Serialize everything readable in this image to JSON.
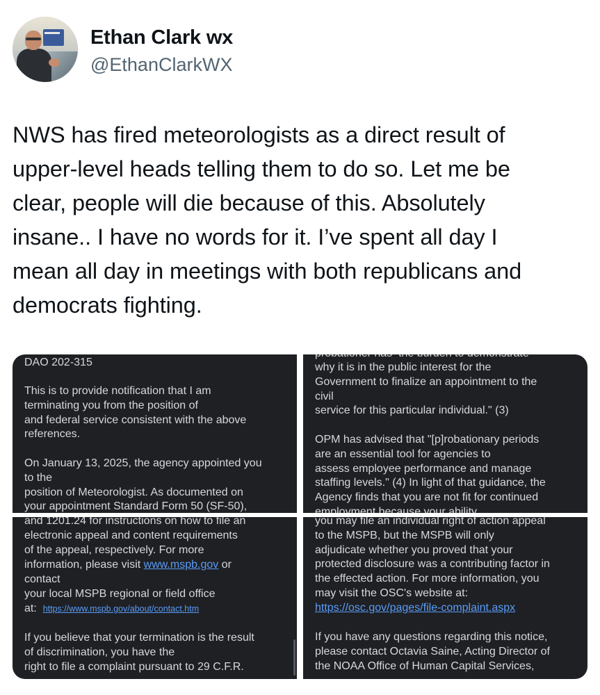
{
  "author": {
    "display_name": "Ethan Clark wx",
    "handle": "@EthanClarkWX",
    "avatar_icon": "profile-photo"
  },
  "tweet": {
    "text": "NWS has fired meteorologists as a direct result of\nupper-level heads telling them to do so. Let me be\nclear, people will die because of this. Absolutely\ninsane.. I have no words for it. I’ve spent all day I\nmean all day in meetings with both republicans and\ndemocrats fighting."
  },
  "media": {
    "panel_top_left": {
      "heading": "DAO 202-315",
      "body": "This is to provide notification that I am\nterminating you from the position of\nand federal service consistent with the above\nreferences.\n\nOn January 13, 2025, the agency appointed you\nto the\nposition of Meteorologist. As documented on\nyour appointment Standard Form 50 (SF-50),"
    },
    "panel_top_right": {
      "cut_line": "probationer has  the burden to demonstrate",
      "body": "why it is in the public interest for the\nGovernment to finalize an appointment to the\ncivil\nservice for this particular individual.\" (3)\n\nOPM has advised that \"[p]robationary periods\nare an essential tool for agencies to\nassess employee performance and manage\nstaffing levels.\" (4) In light of that guidance, the\nAgency finds that you are not fit for continued",
      "cut_bottom": "employment because your ability"
    },
    "panel_bottom_left": {
      "line1": "and 1201.24 for instructions on how to file an",
      "line2": "electronic appeal and content requirements",
      "line3": "of the appeal, respectively. For more",
      "line4_prefix": "information, please visit ",
      "line4_link": "www.mspb.gov",
      "line4_suffix": " or",
      "line5": "contact",
      "line6": "your local MSPB regional or field office",
      "line7_prefix": "at:  ",
      "line7_link": "https://www.mspb.gov/about/contact.htm",
      "para2": "If you believe that your termination is the result\nof discrimination, you have the\nright to file a complaint pursuant to 29 C.F.R."
    },
    "panel_bottom_right": {
      "body": "you may file an individual right of action appeal\nto the MSPB, but the MSPB will only\nadjudicate whether you proved that your\nprotected disclosure was a contributing factor in\nthe effected action. For more information, you\nmay visit the OSC's website at:",
      "link": "https://osc.gov/pages/file-complaint.aspx",
      "para2": "If you have any questions regarding this notice,\nplease contact Octavia Saine, Acting Director of\nthe NOAA Office of Human Capital Services,"
    }
  }
}
